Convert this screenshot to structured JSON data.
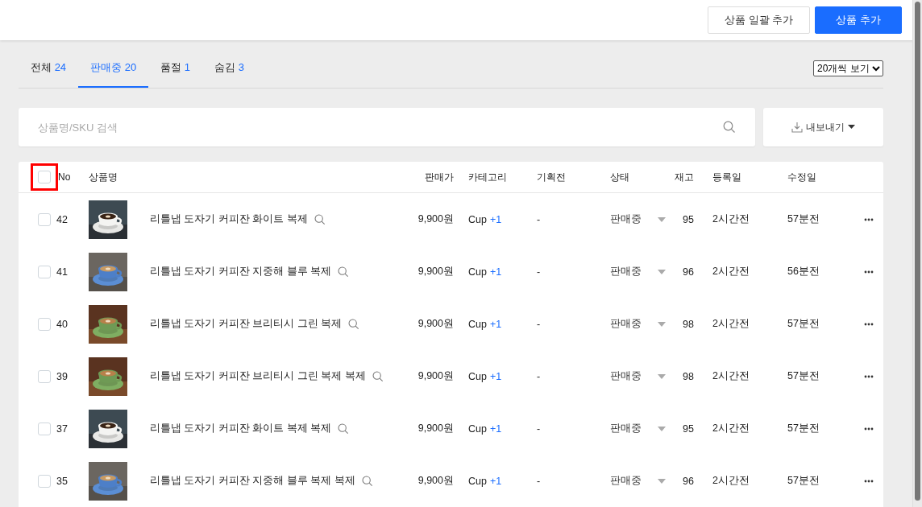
{
  "header": {
    "buttons": [
      {
        "label": "상품 일괄 추가",
        "kind": "secondary"
      },
      {
        "label": "상품 추가",
        "kind": "primary"
      }
    ]
  },
  "tabs": [
    {
      "label": "전체",
      "count": "24",
      "selected": false
    },
    {
      "label": "판매중",
      "count": "20",
      "selected": true
    },
    {
      "label": "품절",
      "count": "1",
      "selected": false
    },
    {
      "label": "숨김",
      "count": "3",
      "selected": false
    }
  ],
  "page_size": {
    "value": "20개씩 보기"
  },
  "search": {
    "placeholder": "상품명/SKU 검색"
  },
  "export_button": {
    "label": "내보내기"
  },
  "table": {
    "select_all": {
      "checked": false,
      "highlighted": true
    },
    "columns": [
      "No",
      "상품명",
      "판매가",
      "카테고리",
      "기획전",
      "상태",
      "재고",
      "등록일",
      "수정일"
    ],
    "rows": [
      {
        "checked": false,
        "no": "42",
        "name": "리틀냅 도자기 커피잔 화이트 복제",
        "price": "9,900원",
        "category": "Cup",
        "category_extra": "+1",
        "promotion": "-",
        "status": "판매중",
        "stock": "95",
        "created": "2시간전",
        "updated": "57분전"
      },
      {
        "checked": false,
        "no": "41",
        "name": "리틀냅 도자기 커피잔 지중해 블루 복제",
        "price": "9,900원",
        "category": "Cup",
        "category_extra": "+1",
        "promotion": "-",
        "status": "판매중",
        "stock": "96",
        "created": "2시간전",
        "updated": "56분전"
      },
      {
        "checked": false,
        "no": "40",
        "name": "리틀냅 도자기 커피잔 브리티시 그린 복제",
        "price": "9,900원",
        "category": "Cup",
        "category_extra": "+1",
        "promotion": "-",
        "status": "판매중",
        "stock": "98",
        "created": "2시간전",
        "updated": "57분전"
      },
      {
        "checked": false,
        "no": "39",
        "name": "리틀냅 도자기 커피잔 브리티시 그린 복제 복제",
        "price": "9,900원",
        "category": "Cup",
        "category_extra": "+1",
        "promotion": "-",
        "status": "판매중",
        "stock": "98",
        "created": "2시간전",
        "updated": "57분전"
      },
      {
        "checked": false,
        "no": "37",
        "name": "리틀냅 도자기 커피잔 화이트 복제 복제",
        "price": "9,900원",
        "category": "Cup",
        "category_extra": "+1",
        "promotion": "-",
        "status": "판매중",
        "stock": "95",
        "created": "2시간전",
        "updated": "57분전"
      },
      {
        "checked": false,
        "no": "35",
        "name": "리틀냅 도자기 커피잔 지중해 블루 복제 복제",
        "price": "9,900원",
        "category": "Cup",
        "category_extra": "+1",
        "promotion": "-",
        "status": "판매중",
        "stock": "96",
        "created": "2시간전",
        "updated": "57분전"
      }
    ]
  }
}
